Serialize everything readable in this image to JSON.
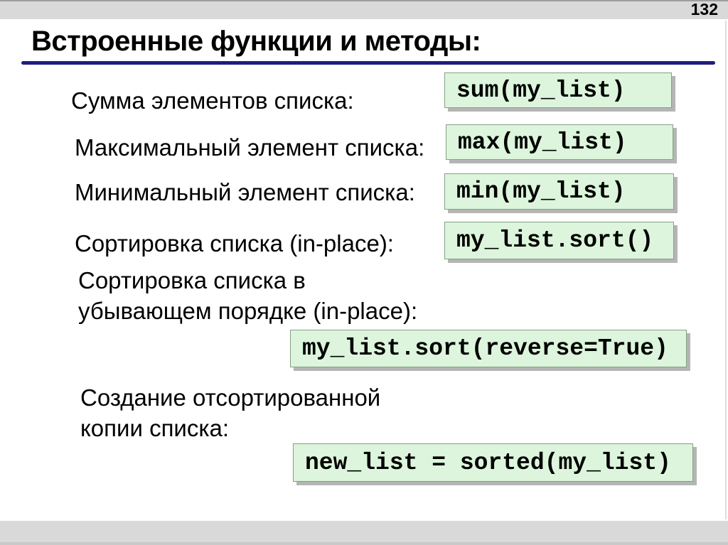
{
  "page": {
    "number": "132"
  },
  "header": {
    "title": "Встроенные функции и методы:"
  },
  "colors": {
    "bar_gray": "#d9d9d9",
    "underline_navy": "#1d1d80",
    "code_box_bg": "#dcf5dc",
    "code_box_border": "#85a085",
    "code_box_shadow": "#b5b5b5",
    "text": "#000000"
  },
  "rows": [
    {
      "label": "Сумма элементов списка:",
      "code": "sum(my_list)"
    },
    {
      "label": "Максимальный элемент списка:",
      "code": "max(my_list)"
    },
    {
      "label": "Минимальный элемент списка:",
      "code": "min(my_list)"
    },
    {
      "label": "Сортировка списка (in-place):",
      "code": "my_list.sort()"
    },
    {
      "label": "Сортировка списка в\nубывающем порядке (in-place):",
      "code": "my_list.sort(reverse=True)"
    },
    {
      "label": "Создание отсортированной\nкопии списка:",
      "code": "new_list = sorted(my_list)"
    }
  ]
}
